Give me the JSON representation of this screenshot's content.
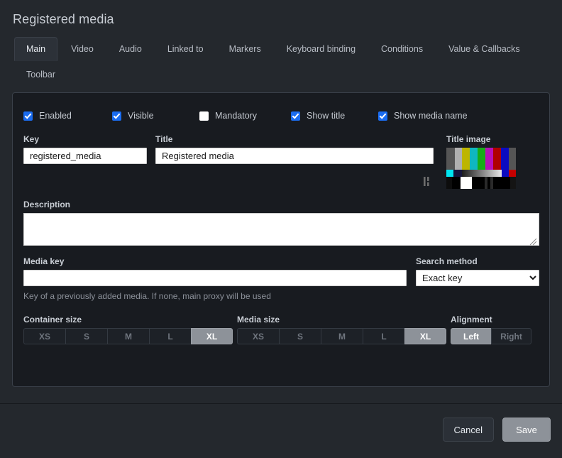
{
  "dialog": {
    "title": "Registered media"
  },
  "tabs": {
    "items": [
      {
        "label": "Main",
        "active": true
      },
      {
        "label": "Video",
        "active": false
      },
      {
        "label": "Audio",
        "active": false
      },
      {
        "label": "Linked to",
        "active": false
      },
      {
        "label": "Markers",
        "active": false
      },
      {
        "label": "Keyboard binding",
        "active": false
      },
      {
        "label": "Conditions",
        "active": false
      },
      {
        "label": "Value & Callbacks",
        "active": false
      },
      {
        "label": "Toolbar",
        "active": false
      }
    ]
  },
  "checkboxes": [
    {
      "label": "Enabled",
      "checked": true
    },
    {
      "label": "Visible",
      "checked": true
    },
    {
      "label": "Mandatory",
      "checked": false
    },
    {
      "label": "Show title",
      "checked": true
    },
    {
      "label": "Show media name",
      "checked": true
    }
  ],
  "fields": {
    "key": {
      "label": "Key",
      "value": "registered_media",
      "placeholder": ""
    },
    "title": {
      "label": "Title",
      "value": "Registered media",
      "placeholder": ""
    },
    "title_image": {
      "label": "Title image",
      "icon": "smpte-test-pattern-thumbnail"
    },
    "description": {
      "label": "Description",
      "value": "",
      "placeholder": ""
    },
    "media_key": {
      "label": "Media key",
      "value": "",
      "placeholder": "",
      "hint": "Key of a previously added media. If none, main proxy will be used"
    },
    "search_method": {
      "label": "Search method",
      "selected": "Exact key",
      "options": [
        "Exact key"
      ]
    }
  },
  "groups": {
    "container_size": {
      "label": "Container size",
      "options": [
        "XS",
        "S",
        "M",
        "L",
        "XL"
      ],
      "selected": "XL"
    },
    "media_size": {
      "label": "Media size",
      "options": [
        "XS",
        "S",
        "M",
        "L",
        "XL"
      ],
      "selected": "XL"
    },
    "alignment": {
      "label": "Alignment",
      "options": [
        "Left",
        "Right"
      ],
      "selected": "Left"
    }
  },
  "footer": {
    "cancel_label": "Cancel",
    "save_label": "Save"
  },
  "colors": {
    "accent_checkbox": "#1a6cf0",
    "panel_bg": "#181b20",
    "window_bg": "#24282d",
    "selected_segment": "#8d9299"
  }
}
